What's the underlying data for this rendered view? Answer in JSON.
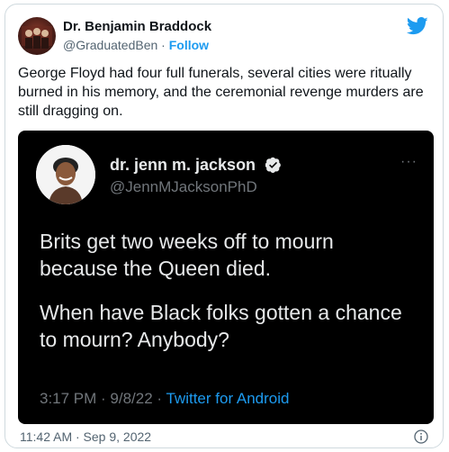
{
  "tweet": {
    "author_name": "Dr. Benjamin Braddock",
    "author_handle": "@GraduatedBen",
    "separator": "·",
    "follow_label": "Follow",
    "text": "George Floyd had four full funerals, several cities were ritually burned in his memory, and the ceremonial revenge murders are still dragging on.",
    "timestamp": "11:42 AM · Sep 9, 2022"
  },
  "quoted_tweet": {
    "author_name": "dr. jenn m. jackson",
    "author_handle": "@JennMJacksonPhD",
    "more_label": "···",
    "text_paragraph_1": "Brits get two weeks off to mourn because the Queen died.",
    "text_paragraph_2": "When have Black folks gotten a chance to mourn? Anybody?",
    "time": "3:17 PM · 9/8/22 · ",
    "source": "Twitter for Android"
  },
  "colors": {
    "accent": "#1d9bf0",
    "quote_background": "#000000",
    "muted_text": "#536471"
  },
  "icons": [
    "twitter-bird-icon",
    "verified-badge-icon",
    "more-icon",
    "info-icon"
  ]
}
